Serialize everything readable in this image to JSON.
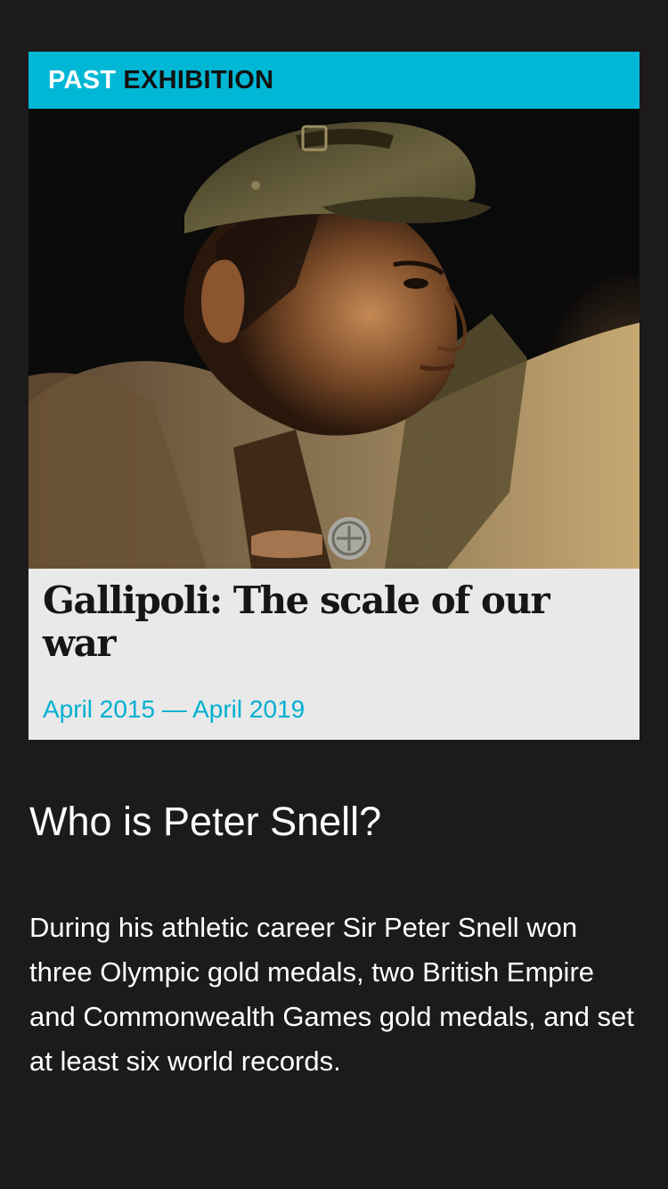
{
  "exhibition_card": {
    "label_past": "PAST",
    "label_exhibition": "EXHIBITION",
    "image_alt": "Soldier in WWI uniform holding a medal",
    "title": "Gallipoli: The scale of our war",
    "dates": "April 2015 — April 2019"
  },
  "article": {
    "heading": "Who is Peter Snell?",
    "body": "During his athletic career Sir Peter Snell won three Olympic gold medals, two British Empire and Commonwealth Games gold medals, and set at least six world records."
  },
  "colors": {
    "background": "#1d1a1b",
    "accent": "#00b8d6",
    "card_caption_bg": "#e9e9e9"
  }
}
